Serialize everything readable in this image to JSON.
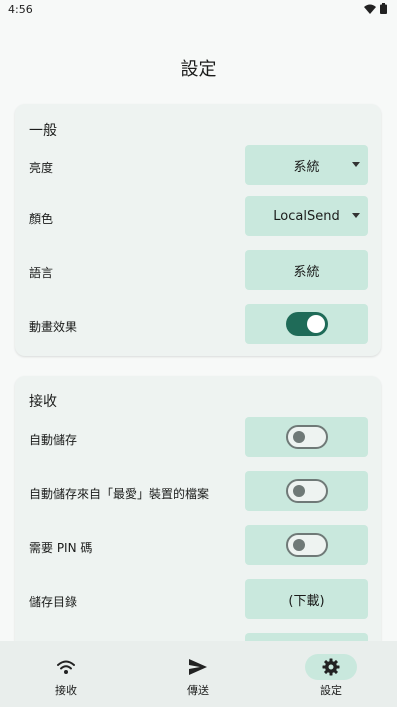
{
  "status": {
    "time": "4:56"
  },
  "page": {
    "title": "設定"
  },
  "general": {
    "title": "一般",
    "brightness": {
      "label": "亮度",
      "value": "系統"
    },
    "color": {
      "label": "顏色",
      "value": "LocalSend"
    },
    "language": {
      "label": "語言",
      "value": "系統"
    },
    "animations": {
      "label": "動畫效果",
      "enabled": true
    }
  },
  "receive": {
    "title": "接收",
    "auto_save": {
      "label": "自動儲存",
      "enabled": false
    },
    "auto_save_favorites": {
      "label": "自動儲存來自「最愛」裝置的檔案",
      "enabled": false
    },
    "require_pin": {
      "label": "需要 PIN 碼",
      "enabled": false
    },
    "save_directory": {
      "label": "儲存目錄",
      "value": "(下載)"
    }
  },
  "nav": {
    "items": [
      {
        "label": "接收",
        "icon": "wifi-icon",
        "active": false
      },
      {
        "label": "傳送",
        "icon": "send-icon",
        "active": false
      },
      {
        "label": "設定",
        "icon": "gear-icon",
        "active": true
      }
    ]
  },
  "colors": {
    "accent": "#1f6b58",
    "control_bg": "#c9e8dd",
    "card_bg": "#eef3f1"
  }
}
